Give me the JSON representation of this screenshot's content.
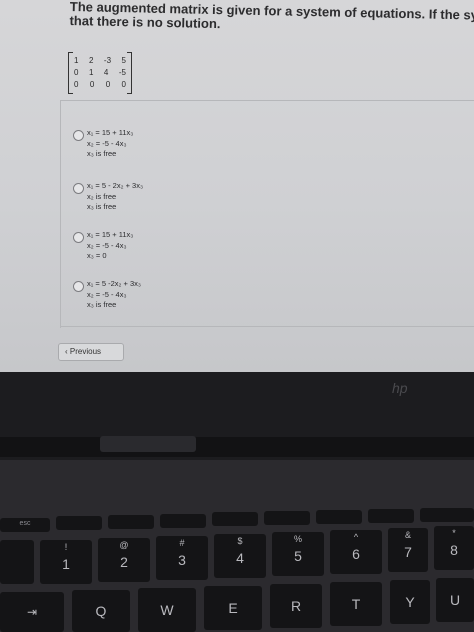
{
  "question": {
    "line1": "The augmented matrix is given for a system of equations. If the system is consistent, find the gen",
    "line2": "that there is no solution."
  },
  "matrix": {
    "rows": [
      [
        "1",
        "2",
        "-3",
        "5"
      ],
      [
        "0",
        "1",
        "4",
        "-5"
      ],
      [
        "0",
        "0",
        "0",
        "0"
      ]
    ]
  },
  "options": [
    {
      "lines": [
        "x₁ = 15 + 11x₃",
        "x₂ = -5 - 4x₃",
        "x₃ is free"
      ]
    },
    {
      "lines": [
        "x₁ = 5 - 2x₂ + 3x₃",
        "x₂ is free",
        "x₃ is free"
      ]
    },
    {
      "lines": [
        "x₁ = 15 + 11x₃",
        "x₂ = -5 - 4x₃",
        "x₃ = 0"
      ]
    },
    {
      "lines": [
        "x₁ = 5 -2x₂ + 3x₃",
        "x₂ = -5 - 4x₃",
        "x₃ is free"
      ]
    }
  ],
  "previous_button": "‹ Previous",
  "laptop": {
    "logo": "hp",
    "number_row": [
      "1",
      "2",
      "3",
      "4",
      "5",
      "6",
      "7",
      "8"
    ],
    "number_symbols": [
      "!",
      "@",
      "#",
      "$",
      "%",
      "^",
      "&",
      "*"
    ],
    "letter_row": [
      "Q",
      "W",
      "E",
      "R",
      "T",
      "Y",
      "U"
    ],
    "esc_label": "esc"
  }
}
